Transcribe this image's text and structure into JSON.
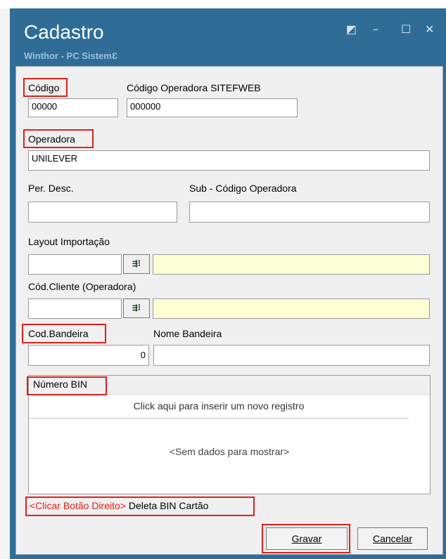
{
  "window": {
    "title": "Cadastro",
    "subtitle": "Winthor - PC SistemƐ",
    "controls": {
      "restore": "◩",
      "minimize": "–",
      "maximize": "☐",
      "close": "✕"
    }
  },
  "form": {
    "codigo": {
      "label": "Código",
      "value": "00000"
    },
    "codigo_sitef": {
      "label": "Código  Operadora SITEFWEB",
      "value": "000000"
    },
    "operadora": {
      "label": "Operadora",
      "value": "UNILEVER"
    },
    "per_desc": {
      "label": "Per. Desc.",
      "value": ""
    },
    "sub_codigo": {
      "label": "Sub - Código Operadora",
      "value": ""
    },
    "layout_importacao": {
      "label": "Layout Importação",
      "code": "",
      "description": ""
    },
    "cod_cliente": {
      "label": "Cód.Cliente (Operadora)",
      "code": "",
      "description": ""
    },
    "cod_bandeira": {
      "label": "Cod.Bandeira",
      "value": "0"
    },
    "nome_bandeira": {
      "label": "Nome Bandeira",
      "value": ""
    }
  },
  "grid": {
    "column_header": "Número BIN",
    "new_row_text": "Click aqui para inserir um novo registro",
    "empty_text": "<Sem dados para mostrar>"
  },
  "hint": {
    "action": "<Clicar Botão Direito>",
    "description": " Deleta BIN Cartão",
    "action_color": "#e0201b"
  },
  "buttons": {
    "save": "Gravar",
    "cancel": "Cancelar"
  },
  "colors": {
    "titlebar": "#2f6c96",
    "highlight": "#e0201b",
    "lookup_field": "#fefed4"
  }
}
